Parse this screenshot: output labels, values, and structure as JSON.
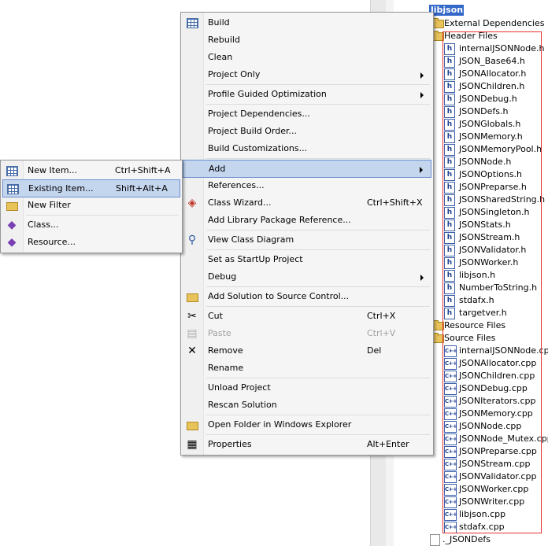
{
  "tree": {
    "project_label": "libjson",
    "items": [
      {
        "label": "External Dependencies",
        "icon": "folder"
      },
      {
        "label": "Header Files",
        "icon": "folder"
      },
      {
        "label": "internalJSONNode.h",
        "icon": "h"
      },
      {
        "label": "JSON_Base64.h",
        "icon": "h"
      },
      {
        "label": "JSONAllocator.h",
        "icon": "h"
      },
      {
        "label": "JSONChildren.h",
        "icon": "h"
      },
      {
        "label": "JSONDebug.h",
        "icon": "h"
      },
      {
        "label": "JSONDefs.h",
        "icon": "h"
      },
      {
        "label": "JSONGlobals.h",
        "icon": "h"
      },
      {
        "label": "JSONMemory.h",
        "icon": "h"
      },
      {
        "label": "JSONMemoryPool.h",
        "icon": "h"
      },
      {
        "label": "JSONNode.h",
        "icon": "h"
      },
      {
        "label": "JSONOptions.h",
        "icon": "h"
      },
      {
        "label": "JSONPreparse.h",
        "icon": "h"
      },
      {
        "label": "JSONSharedString.h",
        "icon": "h"
      },
      {
        "label": "JSONSingleton.h",
        "icon": "h"
      },
      {
        "label": "JSONStats.h",
        "icon": "h"
      },
      {
        "label": "JSONStream.h",
        "icon": "h"
      },
      {
        "label": "JSONValidator.h",
        "icon": "h"
      },
      {
        "label": "JSONWorker.h",
        "icon": "h"
      },
      {
        "label": "libjson.h",
        "icon": "h"
      },
      {
        "label": "NumberToString.h",
        "icon": "h"
      },
      {
        "label": "stdafx.h",
        "icon": "h"
      },
      {
        "label": "targetver.h",
        "icon": "h"
      },
      {
        "label": "Resource Files",
        "icon": "folder"
      },
      {
        "label": "Source Files",
        "icon": "folder"
      },
      {
        "label": "internalJSONNode.cpp",
        "icon": "cpp"
      },
      {
        "label": "JSONAllocator.cpp",
        "icon": "cpp"
      },
      {
        "label": "JSONChildren.cpp",
        "icon": "cpp"
      },
      {
        "label": "JSONDebug.cpp",
        "icon": "cpp"
      },
      {
        "label": "JSONIterators.cpp",
        "icon": "cpp"
      },
      {
        "label": "JSONMemory.cpp",
        "icon": "cpp"
      },
      {
        "label": "JSONNode.cpp",
        "icon": "cpp"
      },
      {
        "label": "JSONNode_Mutex.cpp",
        "icon": "cpp"
      },
      {
        "label": "JSONPreparse.cpp",
        "icon": "cpp"
      },
      {
        "label": "JSONStream.cpp",
        "icon": "cpp"
      },
      {
        "label": "JSONValidator.cpp",
        "icon": "cpp"
      },
      {
        "label": "JSONWorker.cpp",
        "icon": "cpp"
      },
      {
        "label": "JSONWriter.cpp",
        "icon": "cpp"
      },
      {
        "label": "libjson.cpp",
        "icon": "cpp"
      },
      {
        "label": "stdafx.cpp",
        "icon": "cpp"
      },
      {
        "label": "._JSONDefs",
        "icon": "file"
      }
    ]
  },
  "context_menu": {
    "items": [
      {
        "label": "Build",
        "icon": "build-icon"
      },
      {
        "label": "Rebuild"
      },
      {
        "label": "Clean"
      },
      {
        "label": "Project Only",
        "submenu": true
      },
      {
        "sep": true
      },
      {
        "label": "Profile Guided Optimization",
        "submenu": true
      },
      {
        "sep": true
      },
      {
        "label": "Project Dependencies..."
      },
      {
        "label": "Project Build Order..."
      },
      {
        "label": "Build Customizations..."
      },
      {
        "sep": true
      },
      {
        "label": "Add",
        "submenu": true,
        "highlighted": true
      },
      {
        "label": "References..."
      },
      {
        "label": "Class Wizard...",
        "shortcut": "Ctrl+Shift+X",
        "icon": "class-wizard-icon"
      },
      {
        "label": "Add Library Package Reference..."
      },
      {
        "sep": true
      },
      {
        "label": "View Class Diagram",
        "icon": "class-diagram-icon"
      },
      {
        "sep": true
      },
      {
        "label": "Set as StartUp Project"
      },
      {
        "label": "Debug",
        "submenu": true
      },
      {
        "sep": true
      },
      {
        "label": "Add Solution to Source Control...",
        "icon": "source-control-icon"
      },
      {
        "sep": true
      },
      {
        "label": "Cut",
        "shortcut": "Ctrl+X",
        "icon": "scissors-icon"
      },
      {
        "label": "Paste",
        "shortcut": "Ctrl+V",
        "disabled": true,
        "icon": "paste-icon"
      },
      {
        "label": "Remove",
        "shortcut": "Del",
        "icon": "remove-x-icon"
      },
      {
        "label": "Rename"
      },
      {
        "sep": true
      },
      {
        "label": "Unload Project"
      },
      {
        "label": "Rescan Solution"
      },
      {
        "sep": true
      },
      {
        "label": "Open Folder in Windows Explorer",
        "icon": "open-folder-icon"
      },
      {
        "sep": true
      },
      {
        "label": "Properties",
        "shortcut": "Alt+Enter",
        "icon": "properties-icon"
      }
    ]
  },
  "add_submenu": {
    "items": [
      {
        "label": "New Item...",
        "shortcut": "Ctrl+Shift+A",
        "icon": "new-item-icon"
      },
      {
        "label": "Existing Item...",
        "shortcut": "Shift+Alt+A",
        "highlighted": true,
        "icon": "existing-item-icon"
      },
      {
        "label": "New Filter",
        "icon": "new-filter-folder-icon"
      },
      {
        "sep": true
      },
      {
        "label": "Class...",
        "icon": "class-icon"
      },
      {
        "label": "Resource...",
        "icon": "resource-icon"
      }
    ]
  }
}
